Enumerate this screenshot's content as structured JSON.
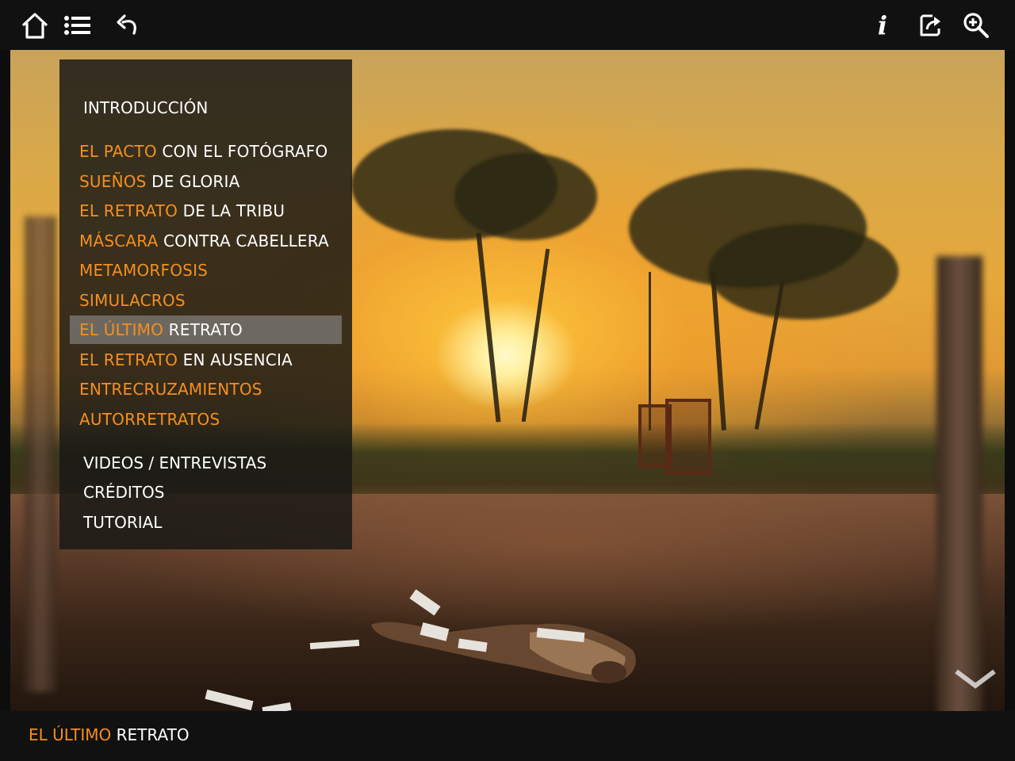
{
  "toolbar": {
    "left_icons": [
      "home-icon",
      "list-icon",
      "back-arrow-icon"
    ],
    "right_icons": [
      "info-icon",
      "share-icon",
      "zoom-in-icon"
    ],
    "info_glyph": "i"
  },
  "menu": {
    "intro": "INTRODUCCIÓN",
    "chapters": [
      {
        "highlight": "EL PACTO",
        "rest": " CON EL FOTÓGRAFO"
      },
      {
        "highlight": "SUEÑOS",
        "rest": " DE GLORIA"
      },
      {
        "highlight": "EL RETRATO",
        "rest": " DE LA TRIBU"
      },
      {
        "highlight": "MÁSCARA",
        "rest": " CONTRA CABELLERA"
      },
      {
        "highlight": "METAMORFOSIS",
        "rest": ""
      },
      {
        "highlight": "SIMULACROS",
        "rest": ""
      },
      {
        "highlight": "EL ÚLTIMO",
        "rest": " RETRATO"
      },
      {
        "highlight": "EL RETRATO",
        "rest": " EN AUSENCIA"
      },
      {
        "highlight": "ENTRECRUZAMIENTOS",
        "rest": ""
      },
      {
        "highlight": "AUTORRETRATOS",
        "rest": ""
      }
    ],
    "selected_index": 6,
    "extras": [
      "VIDEOS / ENTREVISTAS",
      "CRÉDITOS",
      "TUTORIAL"
    ]
  },
  "bottom": {
    "title_highlight": "EL ÚLTIMO",
    "title_rest": " RETRATO"
  },
  "colors": {
    "accent": "#f58f1f",
    "bar": "#111111",
    "text": "#ffffff"
  }
}
